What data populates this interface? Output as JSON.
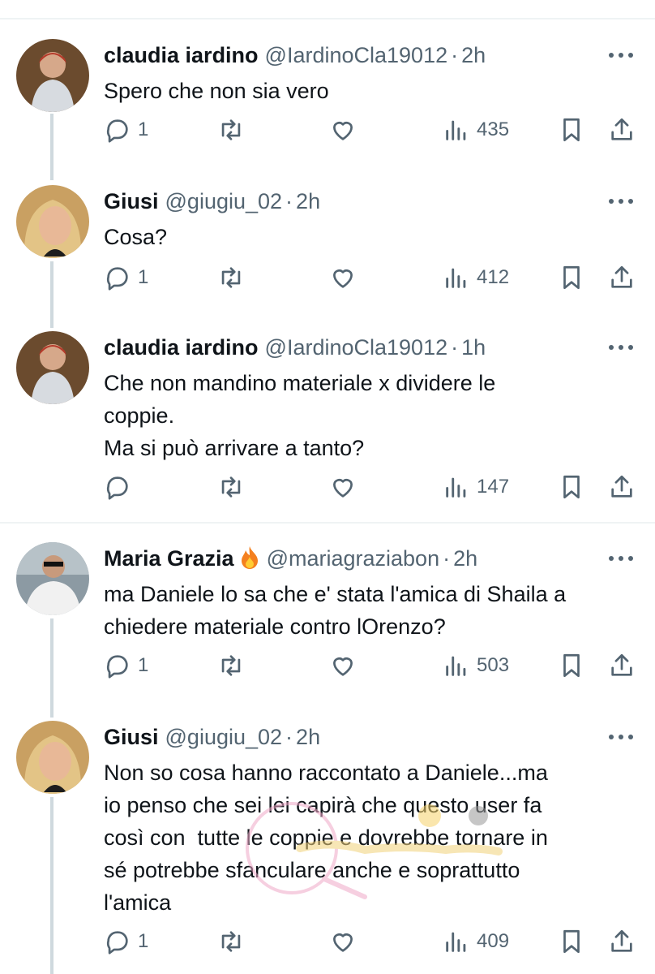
{
  "tweets": [
    {
      "name": "claudia iardino",
      "handle": "@IardinoCla19012",
      "time": "2h",
      "text": [
        "Spero che non sia vero"
      ],
      "replies": "1",
      "views": "435",
      "avatar_color": "#8a6d4a"
    },
    {
      "name": "Giusi",
      "handle": "@giugiu_02",
      "time": "2h",
      "text": [
        "Cosa?"
      ],
      "replies": "1",
      "views": "412",
      "avatar_color": "#d9b779"
    },
    {
      "name": "claudia iardino",
      "handle": "@IardinoCla19012",
      "time": "1h",
      "text": [
        "Che non mandino materiale x dividere le",
        "coppie.",
        "Ma si può arrivare a tanto?"
      ],
      "replies": "",
      "views": "147",
      "avatar_color": "#8a6d4a"
    },
    {
      "name": "Maria Grazia",
      "handle": "@mariagraziabon",
      "time": "2h",
      "text": [
        "ma Daniele lo sa che e' stata l'amica di Shaila a",
        "chiedere materiale contro lOrenzo?"
      ],
      "replies": "1",
      "views": "503",
      "avatar_color": "#7a8a95"
    },
    {
      "name": "Giusi",
      "handle": "@giugiu_02",
      "time": "2h",
      "text": [
        "Non so cosa hanno raccontato a Daniele...ma",
        "io penso che sei lei capirà che questo user fa",
        "così con  tutte le coppie e dovrebbe tornare in",
        "sé potrebbe sfanculare anche e soprattutto",
        "l'amica"
      ],
      "replies": "1",
      "views": "409",
      "avatar_color": "#d9b779"
    }
  ],
  "icons": {
    "reply": "reply-icon",
    "retweet": "retweet-icon",
    "like": "like-icon",
    "views": "views-icon",
    "bookmark": "bookmark-icon",
    "share": "share-icon",
    "more": "more-icon",
    "fire": "fire-emoji-icon"
  },
  "colors": {
    "text": "#0f1419",
    "secondary": "#536471",
    "line": "#cfd9de",
    "divider": "#eff3f4"
  }
}
